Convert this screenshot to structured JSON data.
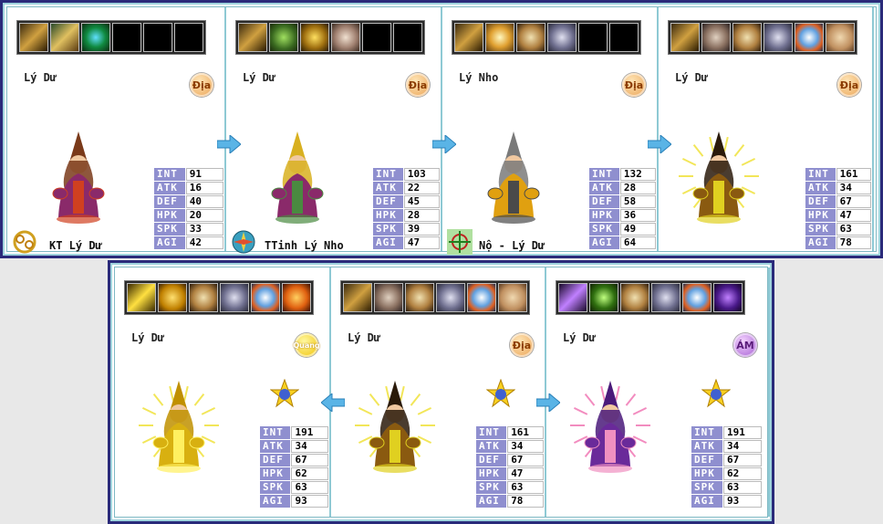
{
  "row1": [
    {
      "name": "Lý Dư",
      "element": "Địa",
      "skills": [
        "sword-icon",
        "spear-icon",
        "orb-icon",
        "empty",
        "empty",
        "empty"
      ],
      "colors": {
        "robe": "#8a2a6a",
        "hat": "#7a3a1a",
        "trim": "#d04020"
      },
      "stats": [
        [
          "INT",
          "91"
        ],
        [
          "ATK",
          "16"
        ],
        [
          "DEF",
          "40"
        ],
        [
          "HPK",
          "20"
        ],
        [
          "SPK",
          "33"
        ],
        [
          "AGI",
          "42"
        ]
      ],
      "evolution": "KT Lý Dư",
      "evo_icon": "knot-icon"
    },
    {
      "name": "Lý Dư",
      "element": "Địa",
      "skills": [
        "sword-icon",
        "shield-icon",
        "yellow-orb-icon",
        "buff-icon",
        "empty",
        "empty"
      ],
      "colors": {
        "robe": "#8a2a6a",
        "hat": "#d8b020",
        "trim": "#4a8a40"
      },
      "stats": [
        [
          "INT",
          "103"
        ],
        [
          "ATK",
          "22"
        ],
        [
          "DEF",
          "45"
        ],
        [
          "HPK",
          "28"
        ],
        [
          "SPK",
          "39"
        ],
        [
          "AGI",
          "47"
        ]
      ],
      "evolution": "TTinh Lý Nho",
      "evo_icon": "compass-icon"
    },
    {
      "name": "Lý Nho",
      "element": "Địa",
      "skills": [
        "sword-icon",
        "burst-icon",
        "hands-icon",
        "pot-icon",
        "empty",
        "empty"
      ],
      "colors": {
        "robe": "#e0a010",
        "hat": "#7a7a7a",
        "trim": "#4a4a4a"
      },
      "stats": [
        [
          "INT",
          "132"
        ],
        [
          "ATK",
          "28"
        ],
        [
          "DEF",
          "58"
        ],
        [
          "HPK",
          "36"
        ],
        [
          "SPK",
          "49"
        ],
        [
          "AGI",
          "64"
        ]
      ],
      "evolution": "Nộ - Lý Dư",
      "evo_icon": "target-icon"
    },
    {
      "name": "Lý Dư",
      "element": "Địa",
      "skills": [
        "sword-icon",
        "elephant-icon",
        "hands-icon",
        "pot-icon",
        "drops-icon",
        "palm-icon"
      ],
      "colors": {
        "robe": "#8a5a10",
        "hat": "#2a1a0a",
        "trim": "#e0d020"
      },
      "stats": [
        [
          "INT",
          "161"
        ],
        [
          "ATK",
          "34"
        ],
        [
          "DEF",
          "67"
        ],
        [
          "HPK",
          "47"
        ],
        [
          "SPK",
          "63"
        ],
        [
          "AGI",
          "78"
        ]
      ],
      "evolution": "",
      "evo_icon": ""
    }
  ],
  "row2": [
    {
      "name": "Lý Dư",
      "element": "Quang",
      "star": "5",
      "skills": [
        "lightning-icon",
        "coin-icon",
        "hands-icon",
        "pot-icon",
        "drops-icon",
        "ex-icon"
      ],
      "colors": {
        "robe": "#d8b010",
        "hat": "#c09000",
        "trim": "#fff060"
      },
      "stats": [
        [
          "INT",
          "191"
        ],
        [
          "ATK",
          "34"
        ],
        [
          "DEF",
          "67"
        ],
        [
          "HPK",
          "62"
        ],
        [
          "SPK",
          "63"
        ],
        [
          "AGI",
          "93"
        ]
      ]
    },
    {
      "name": "Lý Dư",
      "element": "Địa",
      "star": "5",
      "skills": [
        "sword-icon",
        "elephant-icon",
        "hands-icon",
        "pot-icon",
        "drops-icon",
        "palm-icon"
      ],
      "colors": {
        "robe": "#8a5a10",
        "hat": "#2a1a0a",
        "trim": "#e0d020"
      },
      "stats": [
        [
          "INT",
          "161"
        ],
        [
          "ATK",
          "34"
        ],
        [
          "DEF",
          "67"
        ],
        [
          "HPK",
          "47"
        ],
        [
          "SPK",
          "63"
        ],
        [
          "AGI",
          "78"
        ]
      ]
    },
    {
      "name": "Lý Dư",
      "element": "ÁM",
      "star": "5",
      "skills": [
        "dark-spear-icon",
        "green-burst-icon",
        "hands-icon",
        "pot-icon",
        "drops-icon",
        "dark-ex-icon"
      ],
      "colors": {
        "robe": "#6a2a9a",
        "hat": "#4a1a7a",
        "trim": "#f090c0"
      },
      "stats": [
        [
          "INT",
          "191"
        ],
        [
          "ATK",
          "34"
        ],
        [
          "DEF",
          "67"
        ],
        [
          "HPK",
          "62"
        ],
        [
          "SPK",
          "63"
        ],
        [
          "AGI",
          "93"
        ]
      ]
    }
  ]
}
